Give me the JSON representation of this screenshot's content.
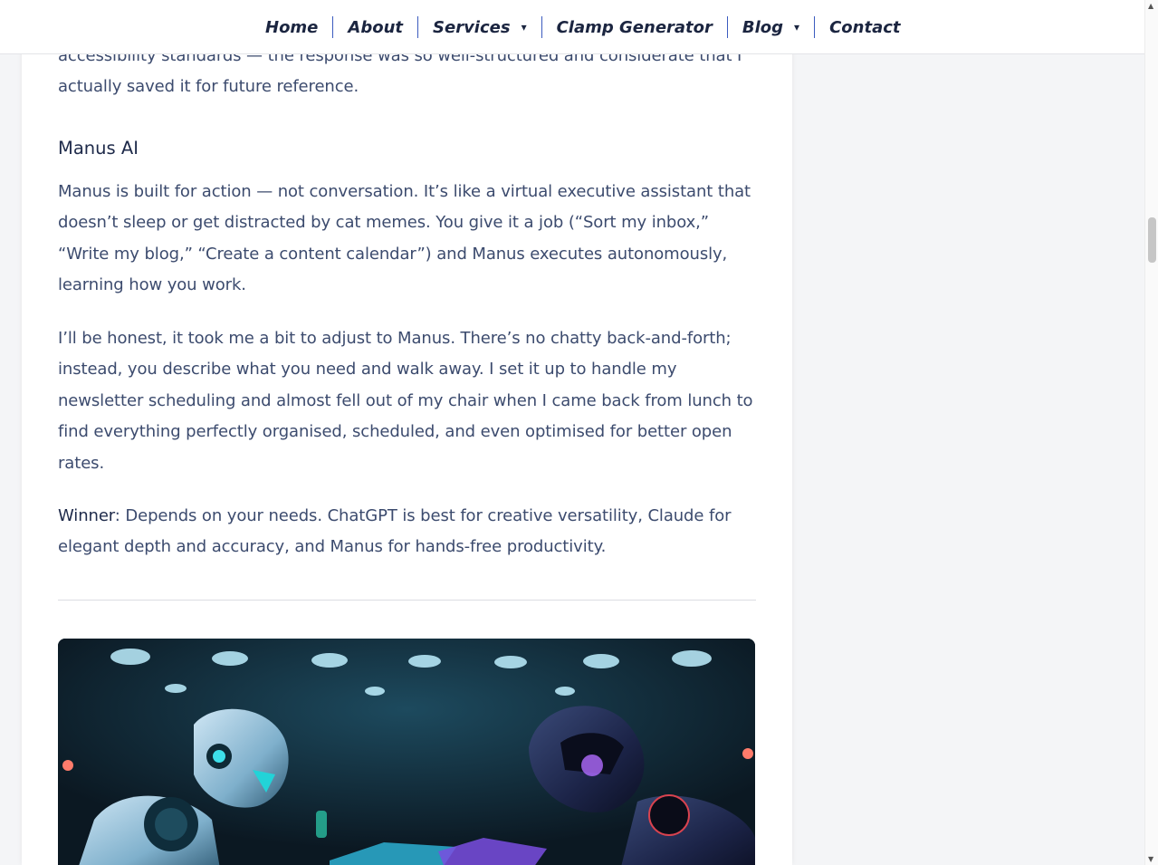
{
  "nav": {
    "items": [
      {
        "label": "Home",
        "dropdown": false
      },
      {
        "label": "About",
        "dropdown": false
      },
      {
        "label": "Services",
        "dropdown": true
      },
      {
        "label": "Clamp Generator",
        "dropdown": false
      },
      {
        "label": "Blog",
        "dropdown": true
      },
      {
        "label": "Contact",
        "dropdown": false
      }
    ],
    "caret_icon": "▾",
    "accent_color": "#3b5bbf"
  },
  "article": {
    "top_text_line1": "accessibility standards — the response was so well-structured and considerate that I",
    "top_text_line2": "actually saved it for future reference.",
    "heading": "Manus AI",
    "para1": "Manus is built for action — not conversation. It’s like a virtual executive assistant that doesn’t sleep or get distracted by cat memes. You give it a job (“Sort my inbox,” “Write my blog,” “Create a content calendar”) and Manus executes autonomously, learning how you work.",
    "para2": "I’ll be honest, it took me a bit to adjust to Manus. There’s no chatty back-and-forth; instead, you describe what you need and walk away. I set it up to handle my newsletter scheduling and almost fell out of my chair when I came back from lunch to find everything perfectly organised, scheduled, and even optimised for better open rates.",
    "winner_label": "Winner",
    "winner_text": ": Depends on your needs. ChatGPT is best for creative versatility, Claude for elegant depth and accuracy, and Manus for hands-free productivity."
  },
  "hero_image": {
    "subject": "two robots facing each other"
  }
}
